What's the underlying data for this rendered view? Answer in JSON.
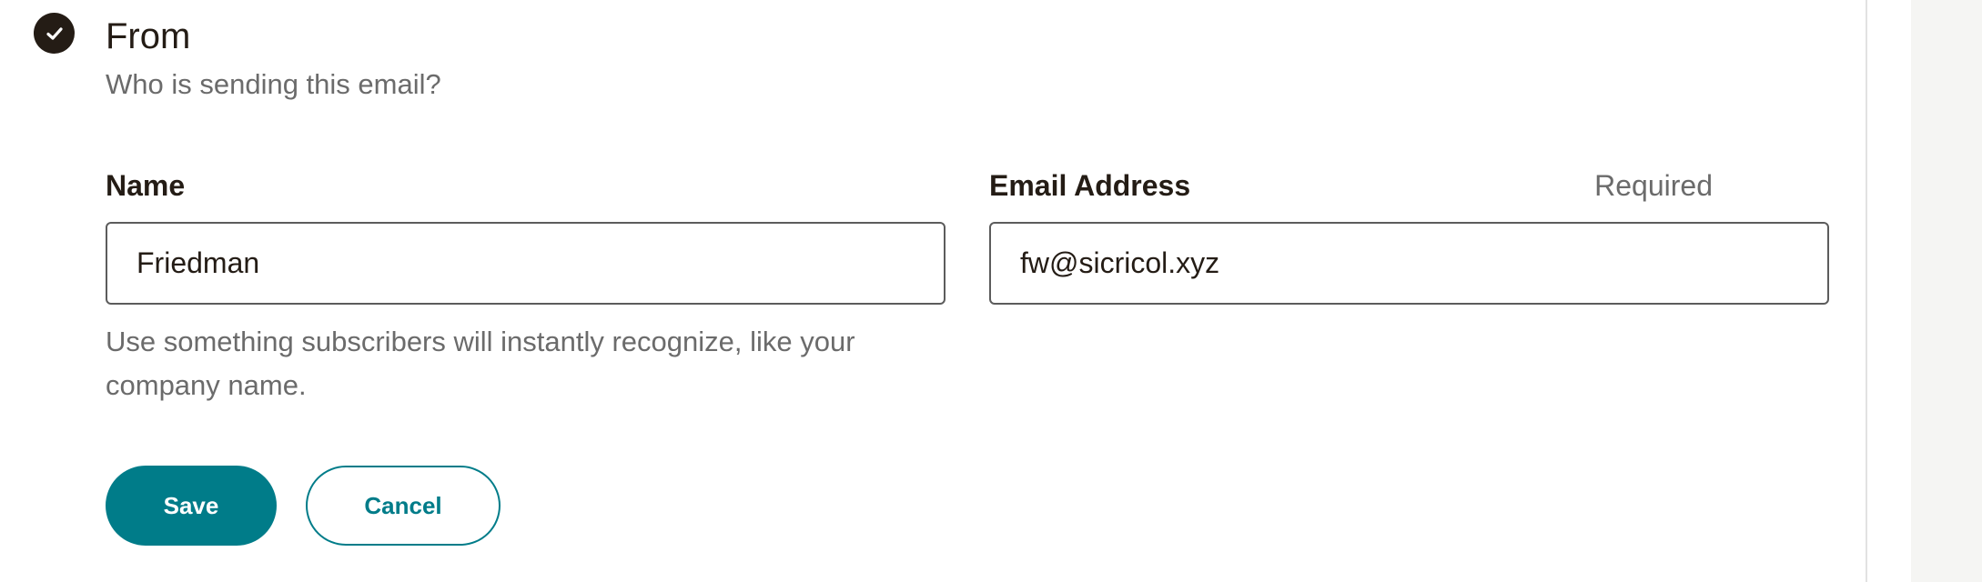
{
  "section": {
    "title": "From",
    "subtitle": "Who is sending this email?",
    "status_icon": "check-circle-icon"
  },
  "form": {
    "name": {
      "label": "Name",
      "value": "Friedman",
      "helper": "Use something subscribers will instantly recognize, like your company name."
    },
    "email": {
      "label": "Email Address",
      "required_label": "Required",
      "value": "fw@sicricol.xyz"
    }
  },
  "actions": {
    "save_label": "Save",
    "cancel_label": "Cancel"
  },
  "colors": {
    "accent": "#007c89",
    "text_primary": "#241c15",
    "text_secondary": "#6b6b6b",
    "side_rail": "#f5f5f3"
  }
}
